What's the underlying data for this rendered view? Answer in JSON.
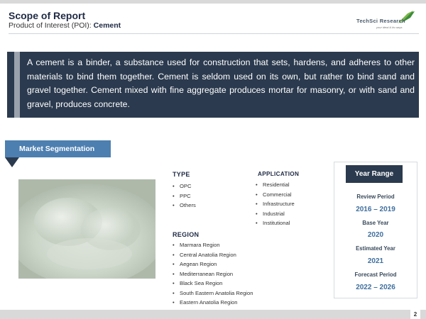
{
  "header": {
    "title": "Scope of Report",
    "subtitle_prefix": "Product of Interest (POI):",
    "subtitle_value": "Cement",
    "logo_text": "TechSci Research",
    "logo_tagline": "your ideal & its ways"
  },
  "intro": {
    "text": "A cement is a binder, a substance used for construction that sets, hardens, and adheres to other materials to bind them together. Cement is seldom used on its own, but rather to bind sand and gravel together. Cement mixed with fine aggregate produces mortar for masonry, or with sand and gravel, produces concrete."
  },
  "segmentation": {
    "label": "Market Segmentation",
    "type": {
      "heading": "TYPE",
      "items": [
        "OPC",
        "PPC",
        "Others"
      ]
    },
    "application": {
      "heading": "APPLICATION",
      "items": [
        "Residential",
        "Commercial",
        "Infrastructure",
        "Industrial",
        "Institutional"
      ]
    },
    "region": {
      "heading": "REGION",
      "items": [
        "Marmara Region",
        "Central Anatolia Region",
        "Aegean Region",
        "Mediterranean Region",
        "Black Sea Region",
        "South Eastern Anatolia Region",
        "Eastern Anatolia Region"
      ]
    }
  },
  "year_range": {
    "title": "Year Range",
    "review_label": "Review Period",
    "review_value": "2016 – 2019",
    "base_label": "Base Year",
    "base_value": "2020",
    "estimated_label": "Estimated Year",
    "estimated_value": "2021",
    "forecast_label": "Forecast Period",
    "forecast_value": "2022 – 2026"
  },
  "footer": {
    "page_number": "2"
  },
  "colors": {
    "navy": "#2b3a4e",
    "accent_blue": "#4d7fb0",
    "value_blue": "#3f6f9f",
    "logo_green": "#7ab648"
  },
  "icons": {
    "logo": "techsci-logo",
    "photo": "cement-powder-photo"
  }
}
